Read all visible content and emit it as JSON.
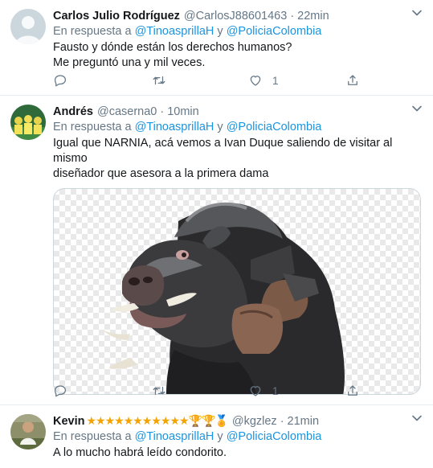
{
  "tweets": [
    {
      "name": "Carlos Julio Rodríguez",
      "handle": "@CarlosJ88601463",
      "dot": "·",
      "time": "22min",
      "reply_prefix": "En respuesta a",
      "mention_1": "@TinoasprillaH",
      "reply_and": "y",
      "mention_2": "@PoliciaColombia",
      "text_line_1": "Fausto y dónde están los derechos humanos?",
      "text_line_2": "Me preguntó una y mil veces.",
      "reply_count": "",
      "retweet_count": "",
      "like_count": "1"
    },
    {
      "name": "Andrés",
      "handle": "@caserna0",
      "dot": "·",
      "time": "10min",
      "reply_prefix": "En respuesta a",
      "mention_1": "@TinoasprillaH",
      "reply_and": "y",
      "mention_2": "@PoliciaColombia",
      "text_line_1": "Igual que NARNIA, acá vemos a Ivan Duque saliendo de visitar al mismo",
      "text_line_2": "diseñador que asesora a la primera dama",
      "reply_count": "",
      "retweet_count": "",
      "like_count": "1"
    },
    {
      "name": "Kevin",
      "badges": "★★★★★★★★★★★🏆🏆🏅",
      "handle": "@kgzlez",
      "dot": "·",
      "time": "21min",
      "reply_prefix": "En respuesta a",
      "mention_1": "@TinoasprillaH",
      "reply_and": "y",
      "mention_2": "@PoliciaColombia",
      "text_line_1": "A lo mucho habrá leído condorito."
    }
  ],
  "icons": {
    "reply": "reply-icon",
    "retweet": "retweet-icon",
    "like": "heart-icon",
    "share": "share-icon",
    "more": "chevron-down-icon"
  },
  "colors": {
    "link": "#1b95e0",
    "secondary": "#657786",
    "text": "#14171a",
    "border": "#e6ecf0"
  }
}
